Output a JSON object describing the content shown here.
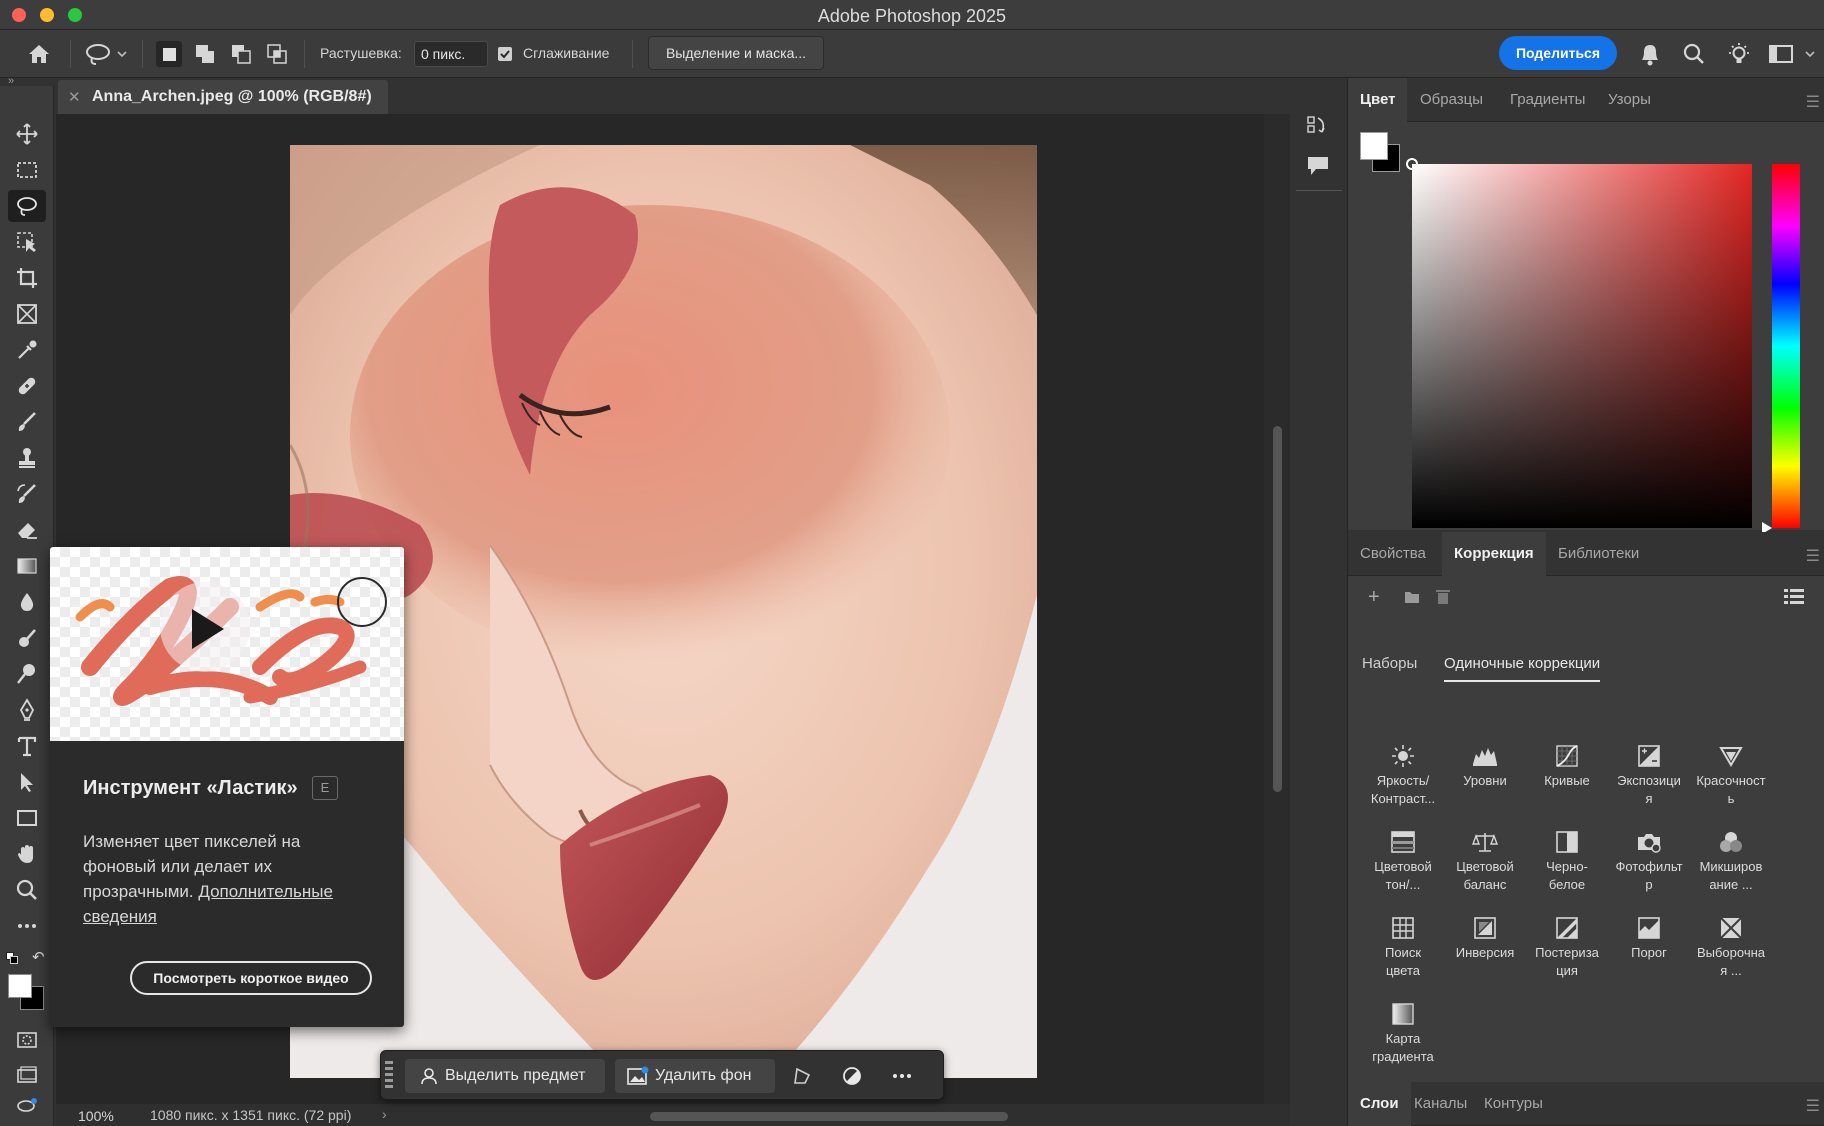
{
  "app": {
    "title": "Adobe Photoshop 2025",
    "share_label": "Поделиться"
  },
  "options_bar": {
    "feather_label": "Растушевка:",
    "feather_value": "0 пикс.",
    "antialias_label": "Сглаживание",
    "antialias_checked": true,
    "select_mask_label": "Выделение и маска..."
  },
  "document": {
    "tab_title": "Anna_Archen.jpeg @ 100% (RGB/8#)",
    "zoom": "100%",
    "info": "1080 пикс. x 1351 пикс. (72 ppi)"
  },
  "tools": [
    {
      "name": "move-tool-icon"
    },
    {
      "name": "marquee-tool-icon"
    },
    {
      "name": "lasso-tool-icon",
      "active": true
    },
    {
      "name": "object-select-tool-icon"
    },
    {
      "name": "crop-tool-icon"
    },
    {
      "name": "frame-tool-icon"
    },
    {
      "name": "eyedropper-tool-icon"
    },
    {
      "name": "healing-brush-tool-icon"
    },
    {
      "name": "brush-tool-icon"
    },
    {
      "name": "clone-stamp-tool-icon"
    },
    {
      "name": "history-brush-tool-icon"
    },
    {
      "name": "eraser-tool-icon"
    },
    {
      "name": "gradient-tool-icon"
    },
    {
      "name": "blur-tool-icon"
    },
    {
      "name": "dodge-tool-icon"
    },
    {
      "name": "magnifier-tool-icon"
    },
    {
      "name": "pen-tool-icon"
    },
    {
      "name": "type-tool-icon"
    },
    {
      "name": "path-select-tool-icon"
    },
    {
      "name": "rectangle-tool-icon"
    },
    {
      "name": "hand-tool-icon"
    },
    {
      "name": "zoom-tool-icon"
    },
    {
      "name": "more-tools-icon"
    }
  ],
  "tooltip": {
    "title": "Инструмент «Ластик»",
    "shortcut": "E",
    "description": "Изменяет цвет пикселей на фоновый или делает их прозрачными.",
    "learn_more": "Дополнительные сведения",
    "video_button": "Посмотреть короткое видео"
  },
  "contextual_taskbar": {
    "select_subject": "Выделить предмет",
    "remove_bg": "Удалить фон"
  },
  "color_panel": {
    "tabs": [
      "Цвет",
      "Образцы",
      "Градиенты",
      "Узоры"
    ],
    "active_tab": "Цвет",
    "hue_color": "#e42623"
  },
  "adjust_panel": {
    "tabs": [
      "Свойства",
      "Коррекция",
      "Библиотеки"
    ],
    "active_tab": "Коррекция",
    "sets_label": "Наборы",
    "single_label": "Одиночные коррекции",
    "items": [
      "Яркость/\nКонтраст...",
      "Уровни",
      "Кривые",
      "Экспозици\nя",
      "Красочност\nь",
      "Цветовой\nтон/...",
      "Цветовой\nбаланс",
      "Черно-\nбелое",
      "Фотофильт\nр",
      "Микширов\nание ...",
      "Поиск\nцвета",
      "Инверсия",
      "Постериза\nция",
      "Порог",
      "Выборочна\nя ...",
      "Карта\nградиента"
    ]
  },
  "layers_panel": {
    "tabs": [
      "Слои",
      "Каналы",
      "Контуры"
    ],
    "active_tab": "Слои"
  }
}
